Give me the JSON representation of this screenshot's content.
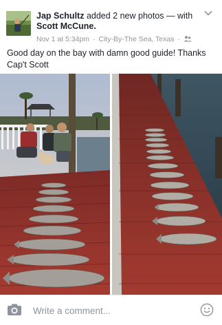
{
  "post": {
    "author": "Jap Schultz",
    "action": "added 2 new photos — with",
    "tagged": "Scott McCune.",
    "time": "Nov 1 at 5:34pm",
    "location": "City-By-The Sea, Texas",
    "separator": "·",
    "audience_icon": "friends-icon",
    "text": "Good day on the bay with damn good guide! Thanks Cap't Scott"
  },
  "comment_bar": {
    "placeholder": "Write a comment...",
    "camera_icon": "camera-icon",
    "emoji_icon": "smiley-icon"
  },
  "colors": {
    "text": "#1d2129",
    "meta": "#90949c",
    "placeholder": "#8d949e",
    "icon": "#8d949e",
    "dock_red": "#8e2f2a"
  }
}
